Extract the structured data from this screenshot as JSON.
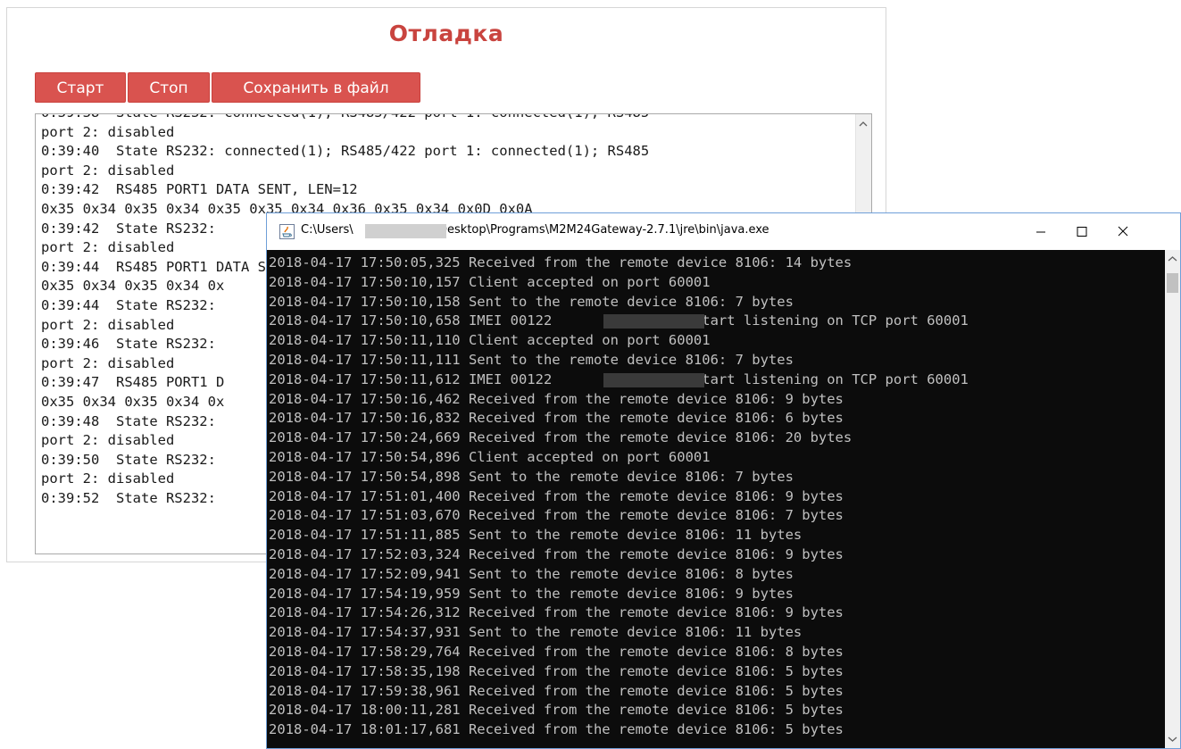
{
  "debug": {
    "title": "Отладка",
    "buttons": {
      "start": "Старт",
      "stop": "Стоп",
      "save": "Сохранить в файл"
    },
    "log_text": "0:39:38  State RS232: connected(1); RS485/422 port 1: connected(1); RS485\nport 2: disabled\n0:39:40  State RS232: connected(1); RS485/422 port 1: connected(1); RS485\nport 2: disabled\n0:39:42  RS485 PORT1 DATA SENT, LEN=12\n0x35 0x34 0x35 0x34 0x35 0x35 0x34 0x36 0x35 0x34 0x0D 0x0A\n0:39:42  State RS232:\nport 2: disabled\n0:39:44  RS485 PORT1 DATA SENT, LEN=12\n0x35 0x34 0x35 0x34 0x\n0:39:44  State RS232:\nport 2: disabled\n0:39:46  State RS232:\nport 2: disabled\n0:39:47  RS485 PORT1 D\n0x35 0x34 0x35 0x34 0x\n0:39:48  State RS232:\nport 2: disabled\n0:39:50  State RS232:\nport 2: disabled\n0:39:52  State RS232:"
  },
  "console": {
    "title_prefix": "C:\\Users\\",
    "title_suffix": "\\Desktop\\Programs\\M2M24Gateway-2.7.1\\jre\\bin\\java.exe",
    "lines": [
      "2018-04-17 17:50:05,325 Received from the remote device 8106: 14 bytes",
      "2018-04-17 17:50:10,157 Client accepted on port 60001",
      "2018-04-17 17:50:10,158 Sent to the remote device 8106: 7 bytes",
      "2018-04-17 17:50:10,658 IMEI 00122               , start listening on TCP port 60001",
      "2018-04-17 17:50:11,110 Client accepted on port 60001",
      "2018-04-17 17:50:11,111 Sent to the remote device 8106: 7 bytes",
      "2018-04-17 17:50:11,612 IMEI 00122               , start listening on TCP port 60001",
      "2018-04-17 17:50:16,462 Received from the remote device 8106: 9 bytes",
      "2018-04-17 17:50:16,832 Received from the remote device 8106: 6 bytes",
      "2018-04-17 17:50:24,669 Received from the remote device 8106: 20 bytes",
      "2018-04-17 17:50:54,896 Client accepted on port 60001",
      "2018-04-17 17:50:54,898 Sent to the remote device 8106: 7 bytes",
      "2018-04-17 17:51:01,400 Received from the remote device 8106: 9 bytes",
      "2018-04-17 17:51:03,670 Received from the remote device 8106: 7 bytes",
      "2018-04-17 17:51:11,885 Sent to the remote device 8106: 11 bytes",
      "2018-04-17 17:52:03,324 Received from the remote device 8106: 9 bytes",
      "2018-04-17 17:52:09,941 Sent to the remote device 8106: 8 bytes",
      "2018-04-17 17:54:19,959 Sent to the remote device 8106: 9 bytes",
      "2018-04-17 17:54:26,312 Received from the remote device 8106: 9 bytes",
      "2018-04-17 17:54:37,931 Sent to the remote device 8106: 11 bytes",
      "2018-04-17 17:58:29,764 Received from the remote device 8106: 8 bytes",
      "2018-04-17 17:58:35,198 Received from the remote device 8106: 5 bytes",
      "2018-04-17 17:59:38,961 Received from the remote device 8106: 5 bytes",
      "2018-04-17 18:00:11,281 Received from the remote device 8106: 5 bytes",
      "2018-04-17 18:01:17,681 Received from the remote device 8106: 5 bytes"
    ]
  },
  "icons": {
    "window_icon": "java-icon",
    "minimize": "minimize-icon",
    "maximize": "maximize-icon",
    "close": "close-icon"
  },
  "colors": {
    "accent": "#d9534f",
    "title_red": "#c9443f",
    "console_bg": "#0c0c0c",
    "console_fg": "#c0c0c0"
  }
}
